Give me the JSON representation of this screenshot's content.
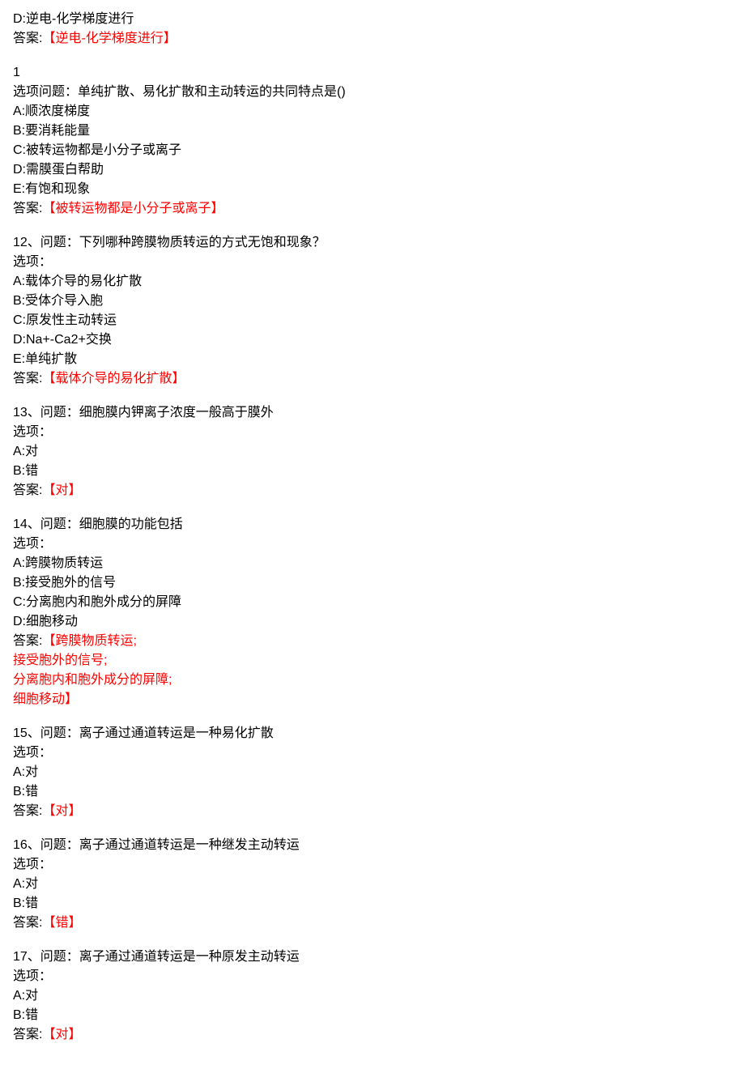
{
  "q_prev": {
    "option_d": "D:逆电-化学梯度进行",
    "answer_label": "答案:",
    "answer_text": "【逆电-化学梯度进行】"
  },
  "side_note": {
    "line1": "1",
    "line2": "选项"
  },
  "q11": {
    "question_inline": "问题：单纯扩散、易化扩散和主动转运的共同特点是()",
    "opt_a": "A:顺浓度梯度",
    "opt_b": "B:要消耗能量",
    "opt_c": "C:被转运物都是小分子或离子",
    "opt_d": "D:需膜蛋白帮助",
    "opt_e": "E:有饱和现象",
    "answer_label": "答案:",
    "answer_text": "【被转运物都是小分子或离子】"
  },
  "q12": {
    "question": "12、问题：下列哪种跨膜物质转运的方式无饱和现象？",
    "options_label": "选项：",
    "opt_a": "A:载体介导的易化扩散",
    "opt_b": "B:受体介导入胞",
    "opt_c": "C:原发性主动转运",
    "opt_d": "D:Na+-Ca2+交换",
    "opt_e": "E:单纯扩散",
    "answer_label": "答案:",
    "answer_text": "【载体介导的易化扩散】"
  },
  "q13": {
    "question": "13、问题：细胞膜内钾离子浓度一般高于膜外",
    "options_label": "选项：",
    "opt_a": "A:对",
    "opt_b": "B:错",
    "answer_label": "答案:",
    "answer_text": "【对】"
  },
  "q14": {
    "question": "14、问题：细胞膜的功能包括",
    "options_label": "选项：",
    "opt_a": "A:跨膜物质转运",
    "opt_b": "B:接受胞外的信号",
    "opt_c": "C:分离胞内和胞外成分的屏障",
    "opt_d": "D:细胞移动",
    "answer_label": "答案:",
    "answer_line1": "【跨膜物质转运;",
    "answer_line2": "接受胞外的信号;",
    "answer_line3": "分离胞内和胞外成分的屏障;",
    "answer_line4": "细胞移动】"
  },
  "q15": {
    "question": "15、问题：离子通过通道转运是一种易化扩散",
    "options_label": "选项：",
    "opt_a": "A:对",
    "opt_b": "B:错",
    "answer_label": "答案:",
    "answer_text": "【对】"
  },
  "q16": {
    "question": "16、问题：离子通过通道转运是一种继发主动转运",
    "options_label": "选项：",
    "opt_a": "A:对",
    "opt_b": "B:错",
    "answer_label": "答案:",
    "answer_text": "【错】"
  },
  "q17": {
    "question": "17、问题：离子通过通道转运是一种原发主动转运",
    "options_label": "选项：",
    "opt_a": "A:对",
    "opt_b": "B:错",
    "answer_label": "答案:",
    "answer_text": "【对】"
  }
}
